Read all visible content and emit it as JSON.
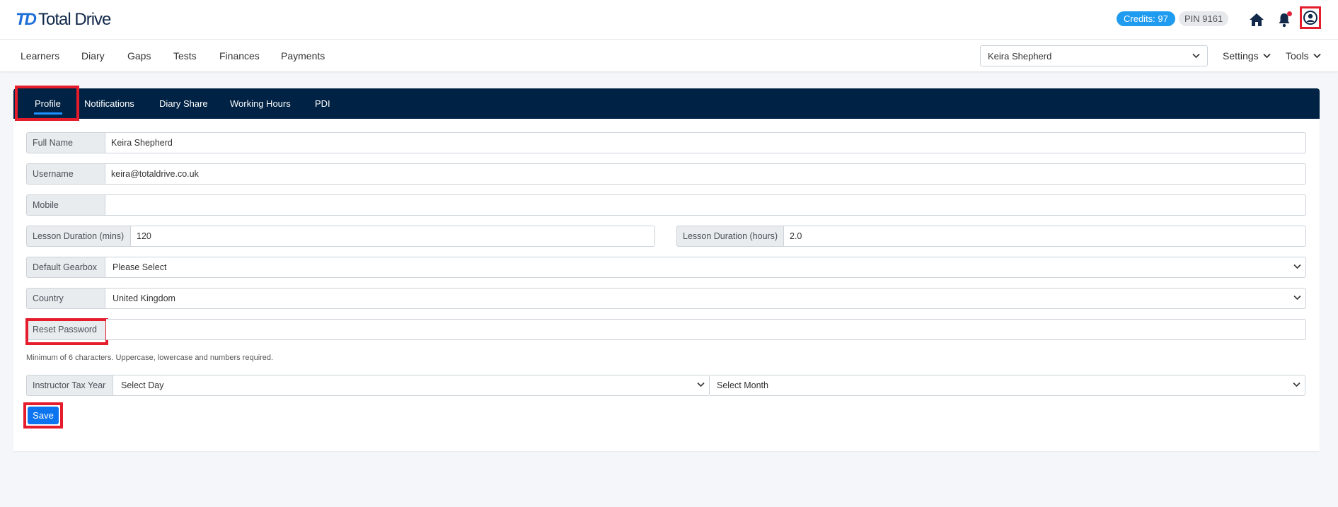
{
  "header": {
    "logo_mark": "TD",
    "logo_text": "Total Drive",
    "credits": "Credits: 97",
    "pin": "PIN 9161",
    "icons": [
      "home-icon",
      "bell-icon",
      "user-icon"
    ],
    "notification_dot_color": "#e0223b"
  },
  "nav": {
    "items": [
      "Learners",
      "Diary",
      "Gaps",
      "Tests",
      "Finances",
      "Payments"
    ],
    "instructor_selected": "Keira Shepherd",
    "settings_label": "Settings",
    "tools_label": "Tools"
  },
  "tabs": {
    "items": [
      "Profile",
      "Notifications",
      "Diary Share",
      "Working Hours",
      "PDI"
    ],
    "active": "Profile"
  },
  "form": {
    "full_name_label": "Full Name",
    "full_name_value": "Keira Shepherd",
    "username_label": "Username",
    "username_value": "keira@totaldrive.co.uk",
    "mobile_label": "Mobile",
    "mobile_value": "",
    "lesson_mins_label": "Lesson Duration (mins)",
    "lesson_mins_value": "120",
    "lesson_hours_label": "Lesson Duration (hours)",
    "lesson_hours_value": "2.0",
    "gearbox_label": "Default Gearbox",
    "gearbox_value": "Please Select",
    "country_label": "Country",
    "country_value": "United Kingdom",
    "reset_password_label": "Reset Password",
    "reset_password_value": "",
    "password_hint": "Minimum of 6 characters. Uppercase, lowercase and numbers required.",
    "tax_year_label": "Instructor Tax Year",
    "tax_day_value": "Select Day",
    "tax_month_value": "Select Month",
    "save_label": "Save"
  },
  "colors": {
    "brand_blue": "#1d6fd8",
    "navy": "#002244",
    "highlight_red": "#e41c2b",
    "save_blue": "#0d74ef"
  }
}
